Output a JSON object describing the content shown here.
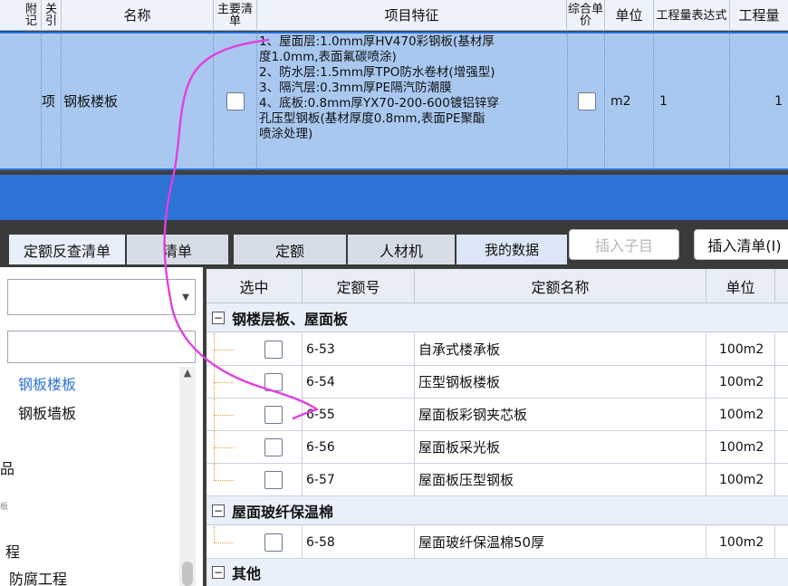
{
  "top_table": {
    "headers": {
      "col_a": "附记",
      "col_b": "关引",
      "name": "名称",
      "main_list": "主要清单",
      "feature": "项目特征",
      "composite": "综合单价",
      "unit": "单位",
      "qty_expr": "工程量表达式",
      "qty": "工程量"
    },
    "row": {
      "type": "项",
      "name": "钢板楼板",
      "feature_lines": [
        "1、屋面层:1.0mm厚HV470彩钢板(基材厚",
        "度1.0mm,表面氟碳喷涂)",
        "2、防水层:1.5mm厚TPO防水卷材(增强型)",
        "3、隔汽层:0.3mm厚PE隔汽防潮膜",
        "4、底板:0.8mm厚YX70-200-600镀铝锌穿",
        "孔压型钢板(基材厚度0.8mm,表面PE聚酯",
        "喷涂处理)"
      ],
      "unit": "m2",
      "qty_expr": "1",
      "qty": "1"
    }
  },
  "tabs": [
    {
      "label": "定额反查清单"
    },
    {
      "label": "清单"
    },
    {
      "label": "定额"
    },
    {
      "label": "人材机"
    },
    {
      "label": "我的数据"
    }
  ],
  "buttons": {
    "insert_child": "插入子目",
    "insert_list": "插入清单(I)"
  },
  "left_panel": {
    "items": [
      "钢板楼板",
      "钢板墙板",
      "品",
      "程",
      "防腐工程"
    ],
    "fragment": "板"
  },
  "grid": {
    "headers": {
      "select": "选中",
      "code": "定额号",
      "name": "定额名称",
      "unit": "单位"
    },
    "groups": [
      {
        "title": "钢楼层板、屋面板",
        "rows": [
          {
            "code": "6-53",
            "name": "自承式楼承板",
            "unit": "100m2"
          },
          {
            "code": "6-54",
            "name": "压型钢板楼板",
            "unit": "100m2"
          },
          {
            "code": "6-55",
            "name": "屋面板彩钢夹芯板",
            "unit": "100m2"
          },
          {
            "code": "6-56",
            "name": "屋面板采光板",
            "unit": "100m2"
          },
          {
            "code": "6-57",
            "name": "屋面板压型钢板",
            "unit": "100m2"
          }
        ]
      },
      {
        "title": "屋面玻纤保温棉",
        "rows": [
          {
            "code": "6-58",
            "name": "屋面玻纤保温棉50厚",
            "unit": "100m2"
          }
        ]
      },
      {
        "title": "其他",
        "rows": []
      }
    ]
  },
  "colors": {
    "selected_row": "#a9c8f0",
    "band": "#2d74d6",
    "annotation": "#e040e0"
  }
}
